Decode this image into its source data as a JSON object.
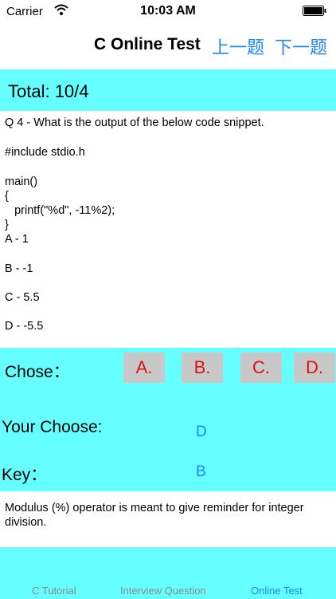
{
  "status": {
    "carrier": "Carrier",
    "time": "10:03 AM"
  },
  "nav": {
    "title": "C Online Test",
    "prev": "上一题",
    "next": "下一题"
  },
  "total": "Total:  10/4",
  "question": {
    "lines": [
      "Q 4 - What is the output of the below code snippet.",
      "#include stdio.h",
      "main()",
      "{",
      "   printf(\"%d\", -11%2);",
      "}",
      "A - 1",
      "B - -1",
      "C - 5.5",
      "D - -5.5"
    ]
  },
  "answer": {
    "chose_label": "Chose：",
    "options": [
      "A.",
      "B.",
      "C.",
      "D."
    ],
    "your_choose_label": "Your Choose:",
    "your_choose_value": "D",
    "key_label": "Key：",
    "key_value": "B"
  },
  "explanation": "Modulus (%) operator is meant to give reminder for integer division.",
  "tabs": [
    {
      "label": "C Tutorial",
      "active": false
    },
    {
      "label": "Interview Question",
      "active": false
    },
    {
      "label": "Online Test",
      "active": true
    }
  ],
  "colors": {
    "accent": "#1a86ff",
    "panel": "#66ffff",
    "option_text": "#e01010"
  }
}
